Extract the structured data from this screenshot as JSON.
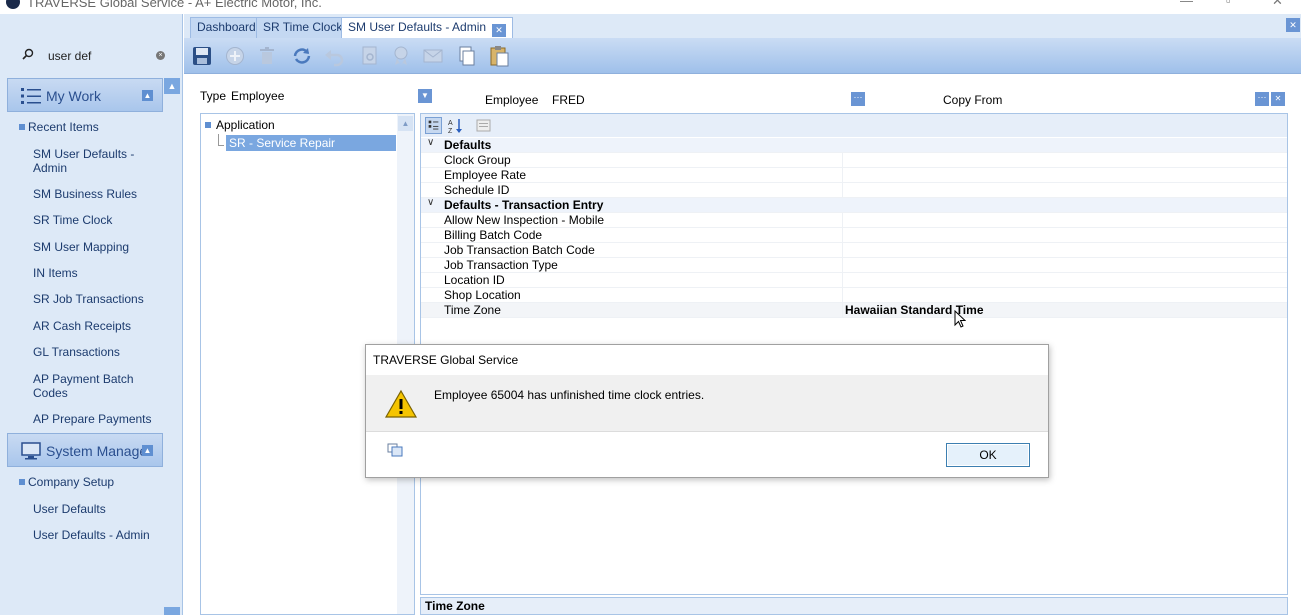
{
  "window": {
    "title": "TRAVERSE Global Service - A+ Electric Motor, Inc."
  },
  "search": {
    "value": "user def"
  },
  "sidebar": {
    "my_work_label": "My Work",
    "recent_items_label": "Recent Items",
    "recent_items": [
      "SM User Defaults - Admin",
      "SM Business Rules",
      "SR Time Clock",
      "SM User Mapping",
      "IN Items",
      "SR Job Transactions",
      "AR Cash Receipts",
      "GL Transactions",
      "AP Payment Batch Codes",
      "AP Prepare Payments"
    ],
    "system_manager_label": "System Manager",
    "company_setup_label": "Company Setup",
    "company_setup_items": [
      "User Defaults",
      "User Defaults - Admin"
    ]
  },
  "tabs": [
    "Dashboard",
    "SR Time Clock",
    "SM User Defaults - Admin"
  ],
  "form": {
    "type_label": "Type",
    "type_value": "Employee",
    "employee_label": "Employee",
    "employee_value": "FRED",
    "copy_from_label": "Copy From",
    "copy_from_value": ""
  },
  "tree": {
    "root": "Application",
    "child": "SR - Service Repair"
  },
  "properties": {
    "cat1": "Defaults",
    "cat1_rows": [
      "Clock Group",
      "Employee Rate",
      "Schedule ID"
    ],
    "cat2": "Defaults - Transaction Entry",
    "cat2_rows": [
      "Allow New Inspection - Mobile",
      "Billing Batch Code",
      "Job Transaction Batch Code",
      "Job Transaction Type",
      "Location ID",
      "Shop Location"
    ],
    "time_zone_name": "Time Zone",
    "time_zone_value": "Hawaiian Standard Time"
  },
  "description": {
    "title": "Time Zone"
  },
  "dialog": {
    "title": "TRAVERSE Global Service",
    "message": "Employee 65004 has unfinished time clock entries.",
    "ok_label": "OK"
  },
  "colors": {
    "accent": "#6a95d4",
    "sidebar_bg": "#dde9f7",
    "selection": "#7aa7e0"
  },
  "icons": [
    "save-icon",
    "add-icon",
    "delete-icon",
    "refresh-icon",
    "undo-icon",
    "print-preview-icon",
    "ribbon-icon",
    "mail-icon",
    "copy-icon",
    "paste-icon",
    "warning-icon",
    "search-icon"
  ]
}
